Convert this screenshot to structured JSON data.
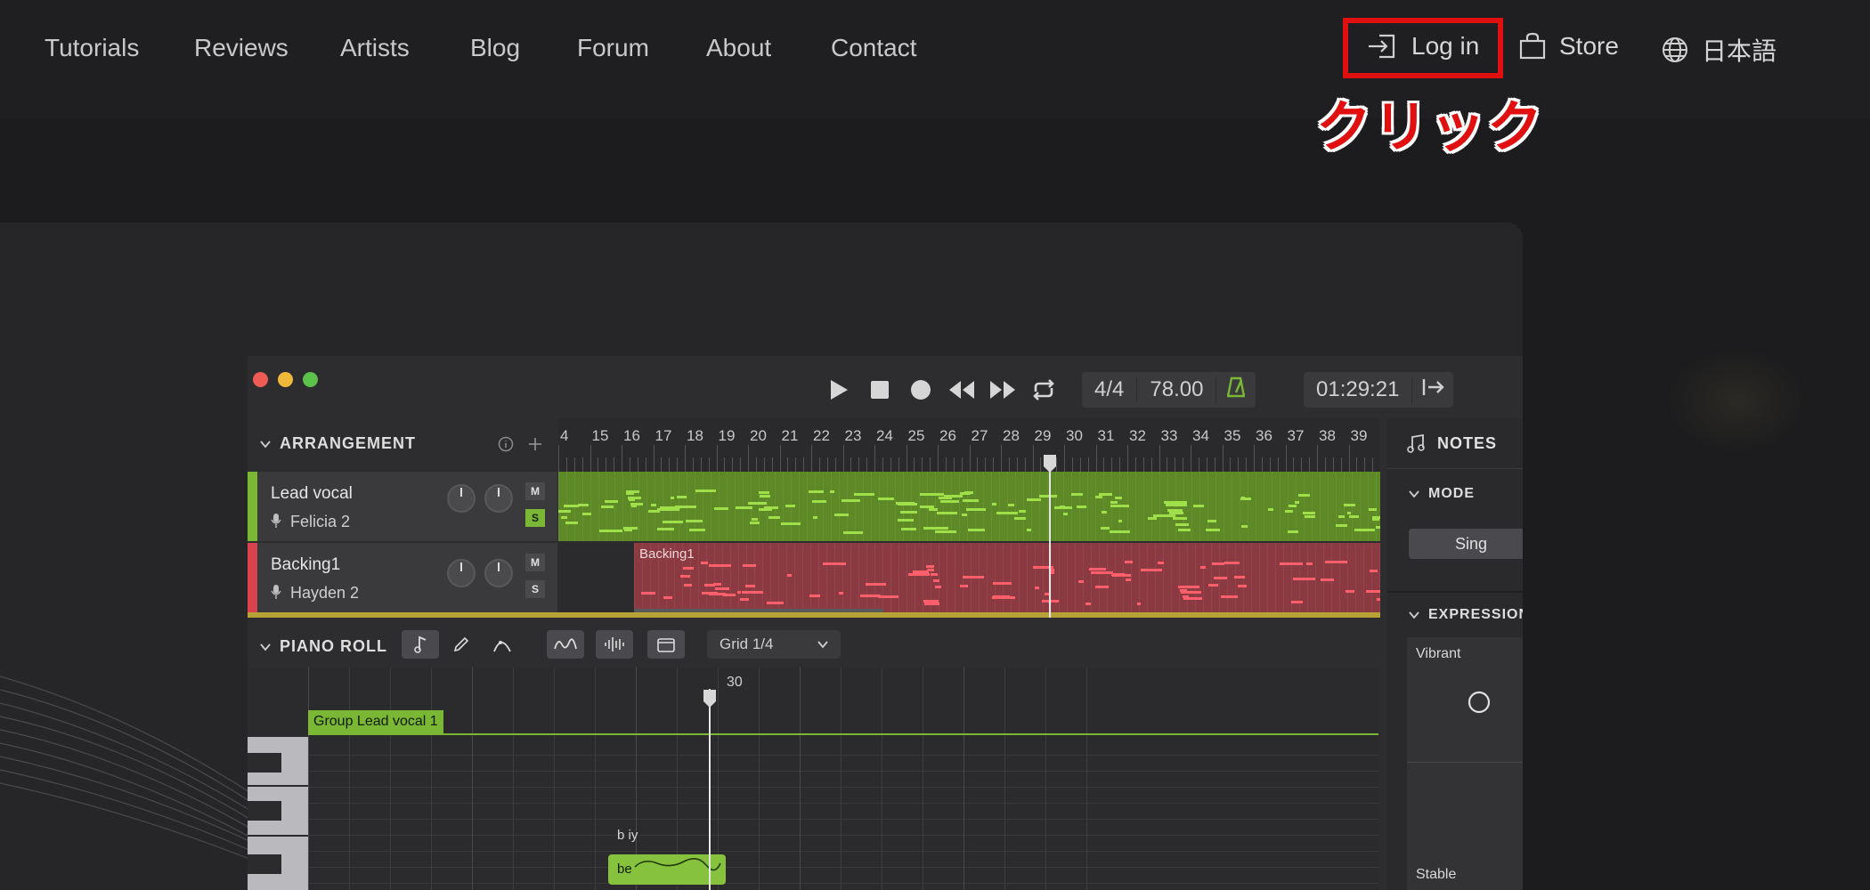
{
  "nav": {
    "links": [
      "Tutorials",
      "Reviews",
      "Artists",
      "Blog",
      "Forum",
      "About",
      "Contact"
    ],
    "login": "Log in",
    "store": "Store",
    "language": "日本語",
    "annotation": "クリック",
    "highlight_color": "#e01010"
  },
  "app": {
    "time_signature": "4/4",
    "tempo": "78.00",
    "time": "01:29:21",
    "arrangement": {
      "title": "ARRANGEMENT",
      "ruler": [
        "4",
        "15",
        "16",
        "17",
        "18",
        "19",
        "20",
        "21",
        "22",
        "23",
        "24",
        "25",
        "26",
        "27",
        "28",
        "29",
        "30",
        "31",
        "32",
        "33",
        "34",
        "35",
        "36",
        "37",
        "38",
        "39",
        "4"
      ],
      "tracks": [
        {
          "name": "Lead vocal",
          "voice": "Felicia 2",
          "color": "#7ab734",
          "mute": "M",
          "solo": "S"
        },
        {
          "name": "Backing1",
          "voice": "Hayden 2",
          "color": "#d8434e",
          "mute": "M",
          "solo": "S",
          "clip_label": "Backing1"
        }
      ]
    },
    "piano_roll": {
      "title": "PIANO ROLL",
      "grid": "Grid 1/4",
      "bar_label": "30",
      "group_tag": "Group Lead vocal 1",
      "note_phoneme": "b iy",
      "note_lyric": "be"
    },
    "notes_panel": {
      "title": "NOTES",
      "mode_label": "MODE",
      "mode_button": "Sing",
      "expression_label": "EXPRESSION",
      "vibrant": "Vibrant",
      "stable": "Stable"
    }
  },
  "colors": {
    "green": "#7ab734",
    "red": "#d8434e",
    "bg": "#1c1c1e"
  }
}
